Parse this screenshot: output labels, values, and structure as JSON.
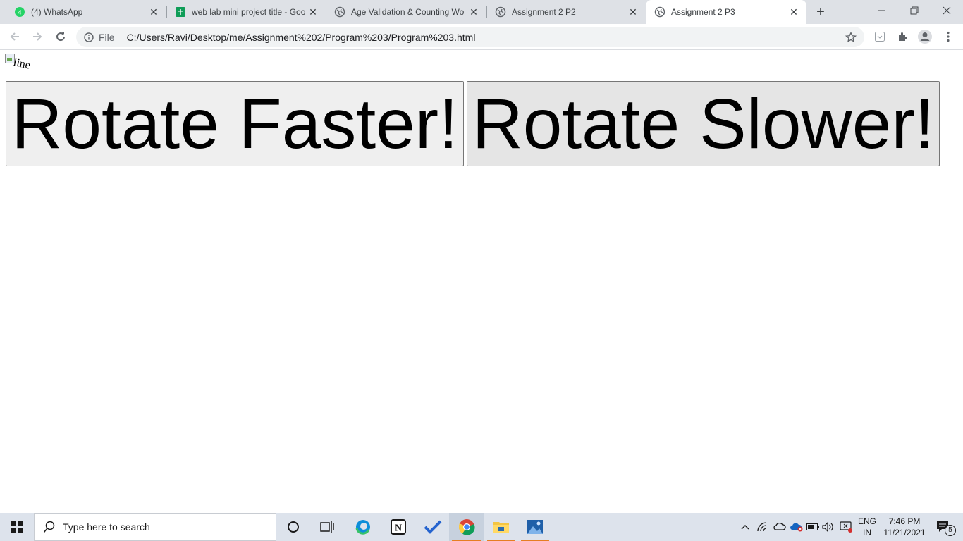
{
  "browser": {
    "tabs": [
      {
        "title": "(4) WhatsApp",
        "icon": "whatsapp-icon"
      },
      {
        "title": "web lab mini project title - Goo",
        "icon": "google-sheets-icon"
      },
      {
        "title": "Age Validation & Counting Wo",
        "icon": "globe-icon"
      },
      {
        "title": "Assignment 2 P2",
        "icon": "globe-icon"
      },
      {
        "title": "Assignment 2 P3",
        "icon": "globe-icon",
        "active": true
      }
    ],
    "address": {
      "scheme": "File",
      "url": "C:/Users/Ravi/Desktop/me/Assignment%202/Program%203/Program%203.html"
    }
  },
  "page": {
    "image_alt": "line",
    "buttons": {
      "faster": "Rotate Faster!",
      "slower": "Rotate Slower!"
    }
  },
  "taskbar": {
    "search_placeholder": "Type here to search",
    "language_top": "ENG",
    "language_bottom": "IN",
    "time": "7:46 PM",
    "date": "11/21/2021",
    "notification_count": "5"
  },
  "colors": {
    "tabstrip": "#dee1e6",
    "taskbar": "#dde3ec",
    "button_bg": "#efefef"
  }
}
